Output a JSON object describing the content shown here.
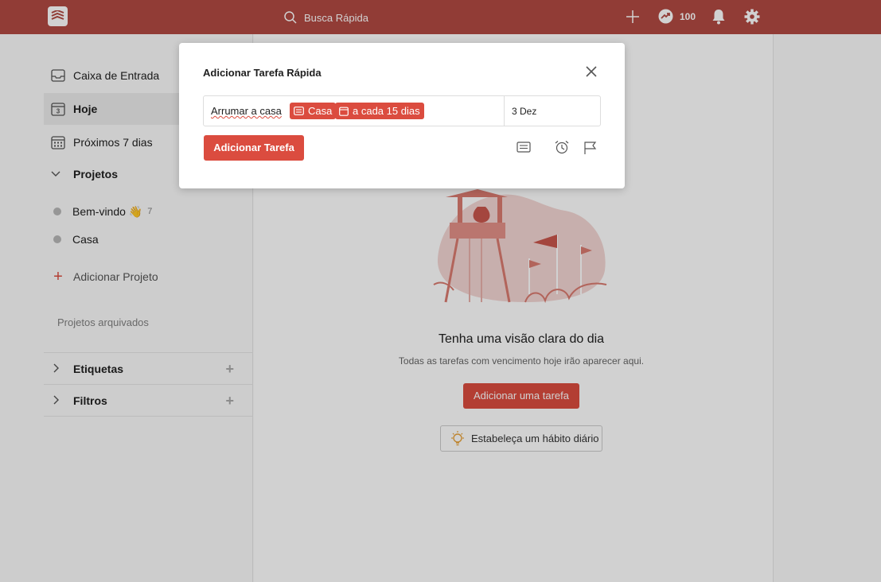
{
  "topbar": {
    "search_placeholder": "Busca Rápida",
    "karma_value": "100"
  },
  "sidebar": {
    "inbox": "Caixa de Entrada",
    "today": "Hoje",
    "today_day": "3",
    "next7": "Próximos 7 dias",
    "projects_header": "Projetos",
    "projects": [
      {
        "name": "Bem-vindo 👋",
        "count": "7"
      },
      {
        "name": "Casa",
        "count": ""
      }
    ],
    "add_project": "Adicionar Projeto",
    "archived": "Projetos arquivados",
    "labels": "Etiquetas",
    "filters": "Filtros"
  },
  "main": {
    "empty_title": "Tenha uma visão clara do dia",
    "empty_subtitle": "Todas as tarefas com vencimento hoje irão aparecer aqui.",
    "add_task_button": "Adicionar uma tarefa",
    "habit_button": "Estabeleça um hábito diário"
  },
  "modal": {
    "title": "Adicionar Tarefa Rápida",
    "task_text": "Arrumar a casa",
    "project_chip": "Casa",
    "recurrence_chip": "a cada 15 dias",
    "date": "3 Dez",
    "submit": "Adicionar Tarefa"
  },
  "colors": {
    "accent": "#db4c3f"
  }
}
